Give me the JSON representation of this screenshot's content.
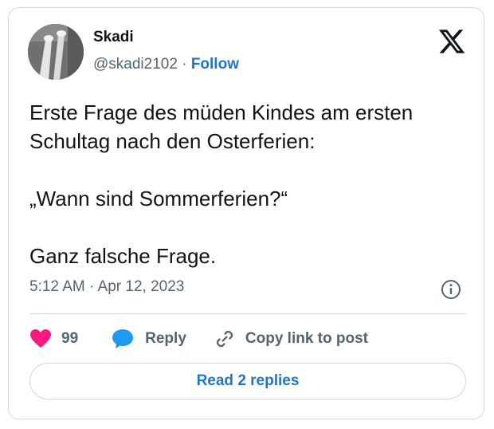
{
  "author": {
    "name": "Skadi",
    "handle": "@skadi2102",
    "separator": "·",
    "follow_label": "Follow",
    "avatar_icon": "avatar-photo"
  },
  "brand": {
    "logo_icon": "x-logo-icon"
  },
  "post": {
    "lines": [
      "Erste Frage des müden Kindes am ersten Schultag nach den Osterferien:",
      "„Wann sind Sommerferien?“",
      "Ganz falsche Frage."
    ],
    "timestamp": "5:12 AM · Apr 12, 2023"
  },
  "actions": {
    "like_count": "99",
    "reply_label": "Reply",
    "copy_label": "Copy link to post"
  },
  "read_replies_label": "Read 2 replies",
  "colors": {
    "heart": "#f91880",
    "reply_bubble": "#1d9bf0",
    "link_blue": "#1d76c9",
    "muted": "#536471",
    "border": "#cfd9de"
  }
}
